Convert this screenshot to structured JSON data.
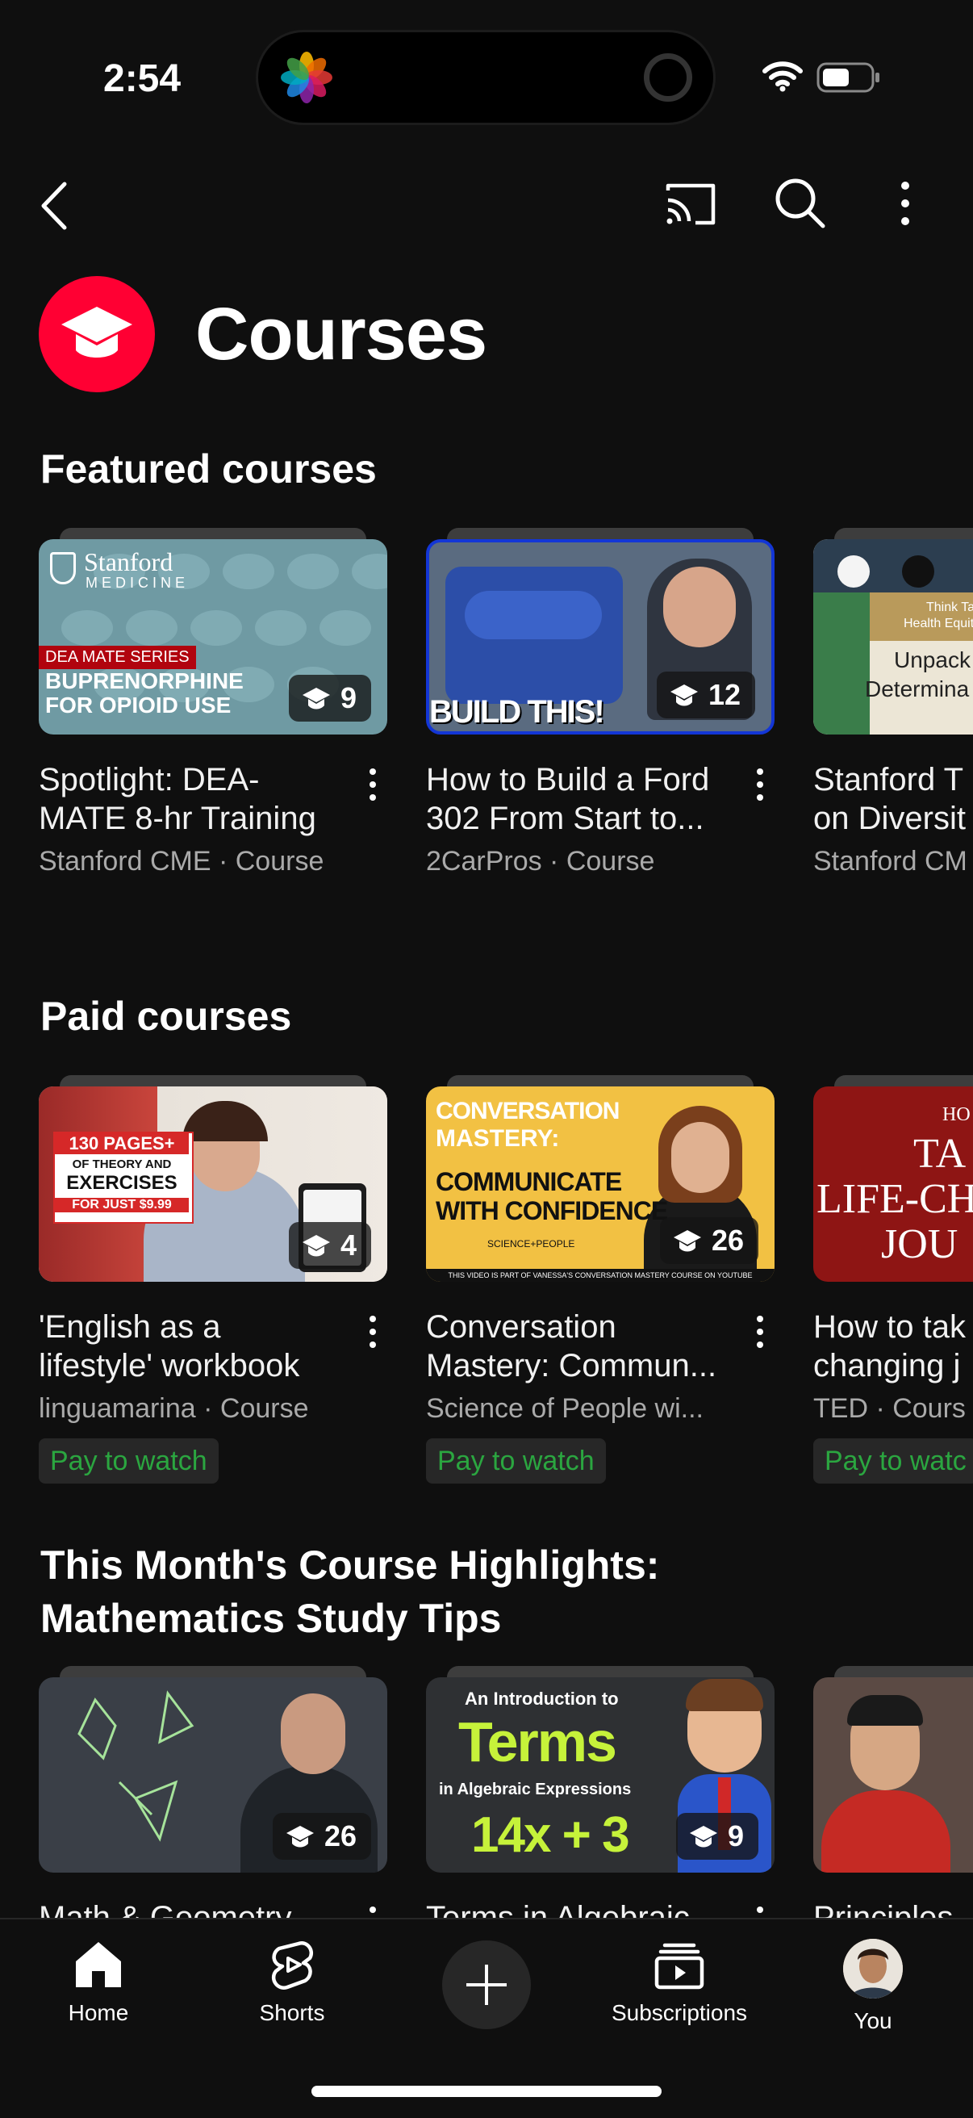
{
  "status_bar": {
    "time": "2:54"
  },
  "header": {
    "title": "Courses"
  },
  "sections": [
    {
      "title": "Featured courses",
      "cards": [
        {
          "title": "Spotlight: DEA-\nMATE 8-hr Training",
          "meta": "Stanford CME · Course",
          "count": "9",
          "thumb_logo": "Stanford",
          "thumb_logo_sub": "MEDICINE",
          "thumb_tag": "DEA MATE SERIES",
          "thumb_line1": "BUPRENORPHINE",
          "thumb_line2": "FOR OPIOID USE"
        },
        {
          "title": "How to Build a Ford\n302 From Start to...",
          "meta": "2CarPros · Course",
          "count": "12",
          "thumb_text": "BUILD THIS!"
        },
        {
          "title": "Stanford T\non Diversit",
          "meta": "Stanford CM",
          "count": "",
          "thumb_text1": "Think Ta",
          "thumb_text2": "Health Equit",
          "thumb_text3": "Unpack",
          "thumb_text4": "Determina"
        }
      ]
    },
    {
      "title": "Paid courses",
      "cards": [
        {
          "title": "'English as a\nlifestyle' workbook",
          "meta": "linguamarina · Course",
          "count": "4",
          "pay": "Pay to watch",
          "thumb_l1": "130 PAGES+",
          "thumb_l2": "OF THEORY AND",
          "thumb_l3": "EXERCISES",
          "thumb_l4": "FOR JUST $9.99"
        },
        {
          "title": "Conversation\nMastery: Commun...",
          "meta": "Science of People wi...",
          "count": "26",
          "pay": "Pay to watch",
          "thumb_l1": "CONVERSATION",
          "thumb_l2": "MASTERY:",
          "thumb_l3": "COMMUNICATE",
          "thumb_l4": "WITH CONFIDENCE",
          "thumb_l5": "SCIENCE+PEOPLE",
          "thumb_footer": "THIS VIDEO IS PART OF VANESSA'S CONVERSATION MASTERY COURSE ON YOUTUBE"
        },
        {
          "title": "How to tak\nchanging j",
          "meta": "TED · Cours",
          "count": "",
          "pay": "Pay to watc",
          "thumb_l1": "HO",
          "thumb_l2": "TA",
          "thumb_l3": "LIFE-CH",
          "thumb_l4": "JOU"
        }
      ]
    },
    {
      "title": "This Month's Course Highlights:\nMathematics Study Tips",
      "cards": [
        {
          "title": "Math & Geometry",
          "meta": "",
          "count": "26"
        },
        {
          "title": "Terms in Algebraic",
          "meta": "",
          "count": "9",
          "thumb_l1": "An Introduction to",
          "thumb_l2": "Terms",
          "thumb_l3": "in Algebraic Expressions",
          "thumb_l4": "14x + 3"
        },
        {
          "title": "Principles",
          "meta": "",
          "count": ""
        }
      ]
    }
  ],
  "bottom_nav": [
    {
      "label": "Home",
      "icon": "home-icon"
    },
    {
      "label": "Shorts",
      "icon": "shorts-icon"
    },
    {
      "label": "",
      "icon": "create-icon"
    },
    {
      "label": "Subscriptions",
      "icon": "subscriptions-icon"
    },
    {
      "label": "You",
      "icon": "avatar"
    }
  ],
  "colors": {
    "background": "#0f0f0f",
    "accent": "#ff0033",
    "pay_green": "#2ba640",
    "meta_gray": "#aaaaaa"
  }
}
